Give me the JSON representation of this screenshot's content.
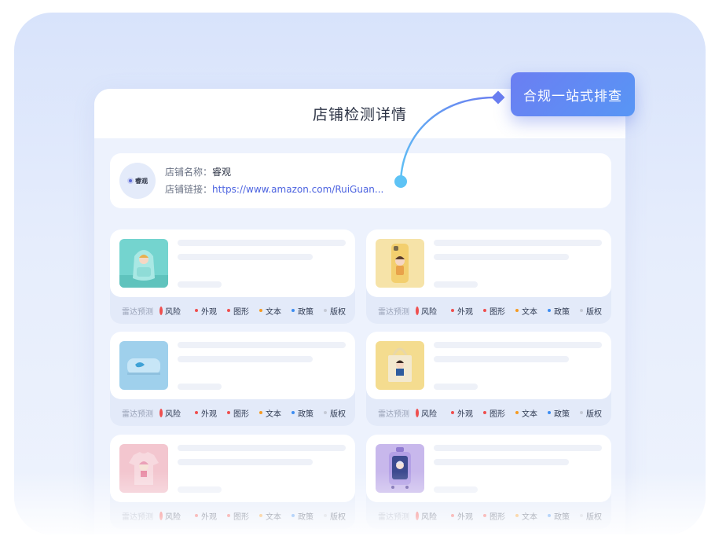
{
  "callout": {
    "label": "合规一站式排查"
  },
  "panel": {
    "title": "店铺检测详情"
  },
  "store": {
    "avatar_text": "睿观",
    "name_label": "店铺名称：",
    "name_value": "睿观",
    "link_label": "店铺链接：",
    "link_value": "https://www.amazon.com/RuiGuan..."
  },
  "products": [
    {
      "thumb": "teal-backpack-image",
      "radar_label": "雷达预测",
      "risk_label": "风险",
      "tags": [
        {
          "label": "外观",
          "color": "#ef4f4f"
        },
        {
          "label": "图形",
          "color": "#ef4f4f"
        },
        {
          "label": "文本",
          "color": "#f59a23"
        },
        {
          "label": "政策",
          "color": "#3d8df2"
        },
        {
          "label": "版权",
          "color": "#c5cad6"
        }
      ]
    },
    {
      "thumb": "yellow-phone-case-image",
      "radar_label": "雷达预测",
      "risk_label": "风险",
      "tags": [
        {
          "label": "外观",
          "color": "#ef4f4f"
        },
        {
          "label": "图形",
          "color": "#ef4f4f"
        },
        {
          "label": "文本",
          "color": "#f59a23"
        },
        {
          "label": "政策",
          "color": "#3d8df2"
        },
        {
          "label": "版权",
          "color": "#c5cad6"
        }
      ]
    },
    {
      "thumb": "blue-pencil-case-image",
      "radar_label": "雷达预测",
      "risk_label": "风险",
      "tags": [
        {
          "label": "外观",
          "color": "#ef4f4f"
        },
        {
          "label": "图形",
          "color": "#ef4f4f"
        },
        {
          "label": "文本",
          "color": "#f59a23"
        },
        {
          "label": "政策",
          "color": "#3d8df2"
        },
        {
          "label": "版权",
          "color": "#c5cad6"
        }
      ]
    },
    {
      "thumb": "tote-bag-image",
      "radar_label": "雷达预测",
      "risk_label": "风险",
      "tags": [
        {
          "label": "外观",
          "color": "#ef4f4f"
        },
        {
          "label": "图形",
          "color": "#ef4f4f"
        },
        {
          "label": "文本",
          "color": "#f59a23"
        },
        {
          "label": "政策",
          "color": "#3d8df2"
        },
        {
          "label": "版权",
          "color": "#c5cad6"
        }
      ]
    },
    {
      "thumb": "pink-tshirt-image",
      "radar_label": "雷达预测",
      "risk_label": "风险",
      "tags": [
        {
          "label": "外观",
          "color": "#ef4f4f"
        },
        {
          "label": "图形",
          "color": "#ef4f4f"
        },
        {
          "label": "文本",
          "color": "#f59a23"
        },
        {
          "label": "政策",
          "color": "#3d8df2"
        },
        {
          "label": "版权",
          "color": "#c5cad6"
        }
      ]
    },
    {
      "thumb": "purple-suitcase-image",
      "radar_label": "雷达预测",
      "risk_label": "风险",
      "tags": [
        {
          "label": "外观",
          "color": "#ef4f4f"
        },
        {
          "label": "图形",
          "color": "#ef4f4f"
        },
        {
          "label": "文本",
          "color": "#f59a23"
        },
        {
          "label": "政策",
          "color": "#3d8df2"
        },
        {
          "label": "版权",
          "color": "#c5cad6"
        }
      ]
    }
  ]
}
